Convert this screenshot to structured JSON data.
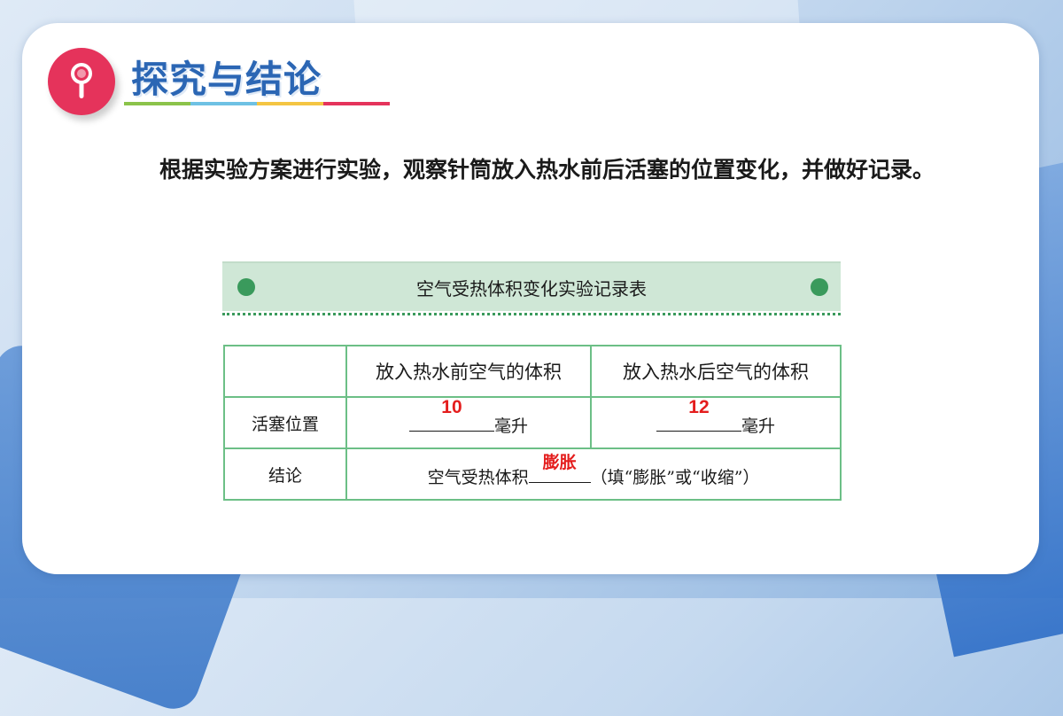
{
  "title": "探究与结论",
  "title_colors": [
    "#8bc34a",
    "#6ec1e4",
    "#f4c542",
    "#e5335b"
  ],
  "icon": "magnifier-icon",
  "paragraph": "根据实验方案进行实验，观察针筒放入热水前后活塞的位置变化，并做好记录。",
  "table": {
    "caption": "空气受热体积变化实验记录表",
    "col_headers": [
      "",
      "放入热水前空气的体积",
      "放入热水后空气的体积"
    ],
    "row_labels": [
      "活塞位置",
      "结论"
    ],
    "before_value": "10",
    "after_value": "12",
    "unit": "毫升",
    "conclusion_prefix": "空气受热体积",
    "conclusion_answer": "膨胀",
    "conclusion_hint": "（填“膨胀”或“收缩”）"
  },
  "accent_colors": {
    "answer": "#e41d1d",
    "table_border": "#6cbf86",
    "header_bg": "#cfe7d6"
  }
}
